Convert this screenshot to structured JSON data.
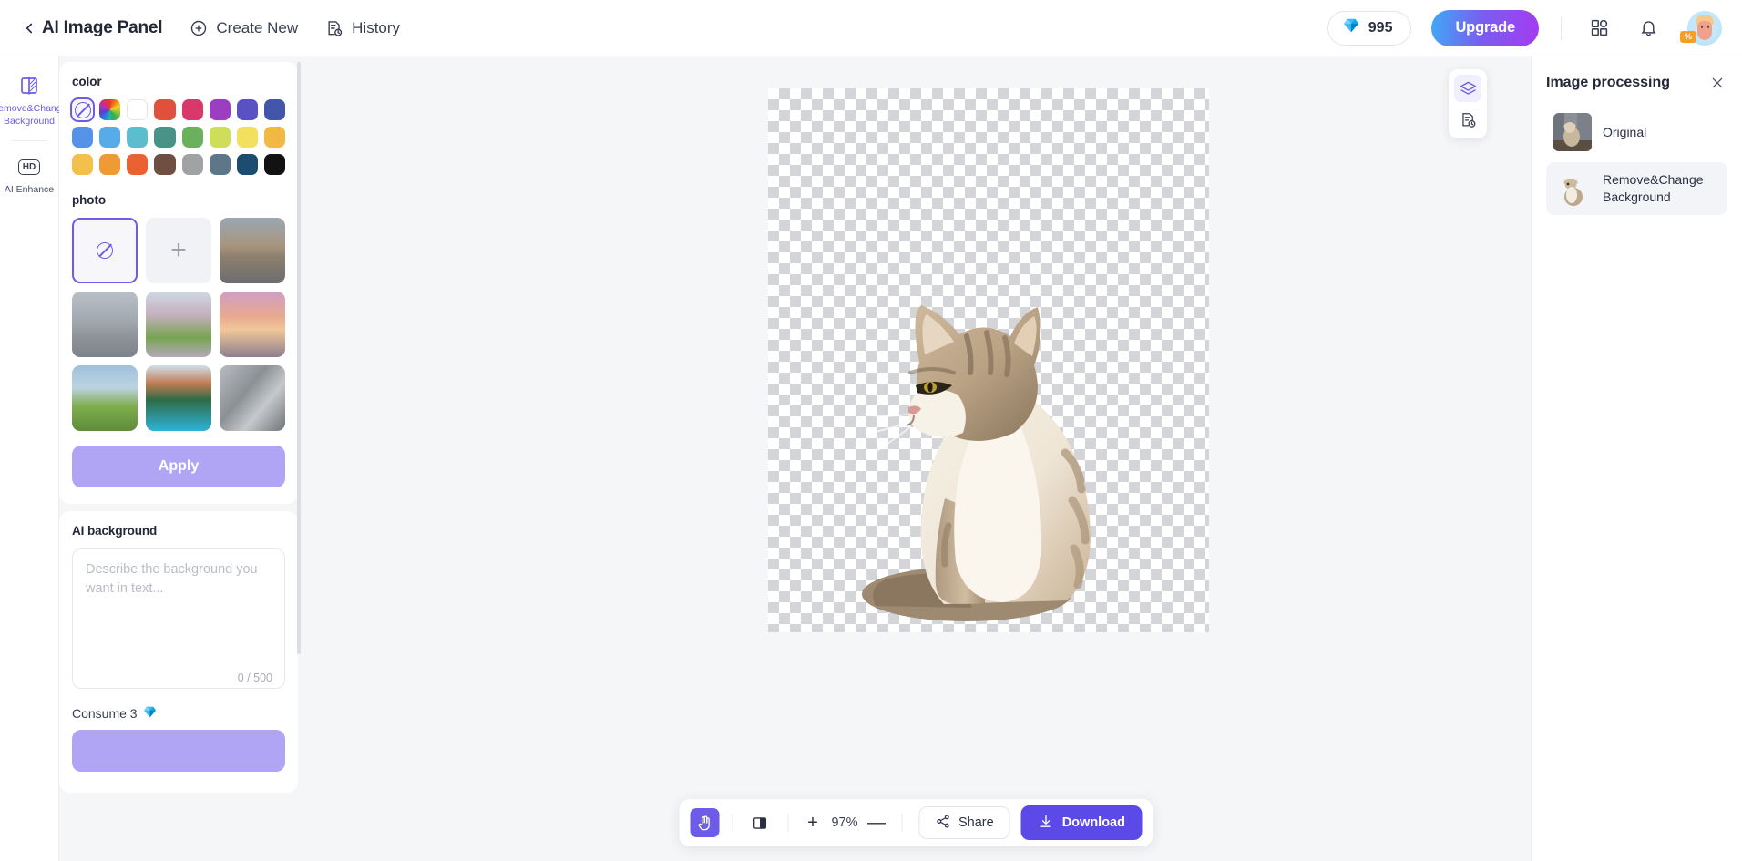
{
  "topbar": {
    "back_icon": "chevron-left-icon",
    "title": "AI Image Panel",
    "create_new": "Create New",
    "history": "History",
    "credits": "995",
    "credits_icon": "gem-icon",
    "upgrade": "Upgrade",
    "apps_icon": "grid-apps-icon",
    "bell_icon": "notification-bell-icon",
    "avatar_badge": "%"
  },
  "rail": {
    "items": [
      {
        "label": "Remove&Change Background",
        "icon": "remove-background-icon",
        "active": true
      },
      {
        "label": "AI Enhance",
        "icon": "hd-icon",
        "active": false
      }
    ]
  },
  "panel": {
    "color_title": "color",
    "colors": [
      {
        "name": "none",
        "hex": "transparent",
        "selected": true
      },
      {
        "name": "rainbow-picker",
        "hex": "rainbow",
        "selected": false
      },
      {
        "name": "white",
        "hex": "#ffffff",
        "selected": false
      },
      {
        "name": "red",
        "hex": "#e0503c",
        "selected": false
      },
      {
        "name": "pink",
        "hex": "#d9386b",
        "selected": false
      },
      {
        "name": "purple",
        "hex": "#9b3fc0",
        "selected": false
      },
      {
        "name": "indigo",
        "hex": "#5a52c4",
        "selected": false
      },
      {
        "name": "navy",
        "hex": "#4156a8",
        "selected": false
      },
      {
        "name": "blue",
        "hex": "#5692e8",
        "selected": false
      },
      {
        "name": "sky",
        "hex": "#57abe8",
        "selected": false
      },
      {
        "name": "cyan",
        "hex": "#5ebccf",
        "selected": false
      },
      {
        "name": "teal",
        "hex": "#499287",
        "selected": false
      },
      {
        "name": "green",
        "hex": "#6bb05a",
        "selected": false
      },
      {
        "name": "lime",
        "hex": "#cedd5a",
        "selected": false
      },
      {
        "name": "yellow",
        "hex": "#f2e05e",
        "selected": false
      },
      {
        "name": "amber",
        "hex": "#f1b944",
        "selected": false
      },
      {
        "name": "gold",
        "hex": "#f3c04b",
        "selected": false
      },
      {
        "name": "orange",
        "hex": "#ef9a34",
        "selected": false
      },
      {
        "name": "deep-orange",
        "hex": "#eb6232",
        "selected": false
      },
      {
        "name": "brown",
        "hex": "#6e4f42",
        "selected": false
      },
      {
        "name": "grey",
        "hex": "#a0a2a4",
        "selected": false
      },
      {
        "name": "slate",
        "hex": "#5e7788",
        "selected": false
      },
      {
        "name": "dark-blue",
        "hex": "#1c4c70",
        "selected": false
      },
      {
        "name": "black",
        "hex": "#121212",
        "selected": false
      }
    ],
    "photo_title": "photo",
    "photos": [
      {
        "name": "none",
        "kind": "none",
        "selected": true
      },
      {
        "name": "upload",
        "kind": "add",
        "selected": false
      },
      {
        "name": "desert-road",
        "kind": "image",
        "selected": false
      },
      {
        "name": "big-ben-london",
        "kind": "image",
        "selected": false
      },
      {
        "name": "blossom-tree",
        "kind": "image",
        "selected": false
      },
      {
        "name": "pink-sunset-lake",
        "kind": "image",
        "selected": false
      },
      {
        "name": "rainbow-field",
        "kind": "image",
        "selected": false
      },
      {
        "name": "mountain-lake",
        "kind": "image",
        "selected": false
      },
      {
        "name": "grey-abstract",
        "kind": "image",
        "selected": false
      }
    ],
    "apply_label": "Apply",
    "ai_bg_title": "AI background",
    "ai_bg_placeholder": "Describe the background you want in text...",
    "ai_bg_value": "",
    "counter": "0 / 500",
    "consume": "Consume 3"
  },
  "canvas": {
    "float_tools": [
      {
        "name": "layers-icon",
        "active": true
      },
      {
        "name": "history-document-icon",
        "active": false
      }
    ],
    "bottom": {
      "hand_tool_icon": "hand-tool-icon",
      "compare_icon": "split-compare-icon",
      "zoom_in": "+",
      "zoom_level": "97%",
      "zoom_out": "—",
      "share": "Share",
      "share_icon": "share-icon",
      "download": "Download",
      "download_icon": "download-icon"
    }
  },
  "right_panel": {
    "title": "Image processing",
    "close_icon": "close-icon",
    "items": [
      {
        "label": "Original",
        "active": false
      },
      {
        "label": "Remove&Change Background",
        "active": true
      }
    ]
  }
}
